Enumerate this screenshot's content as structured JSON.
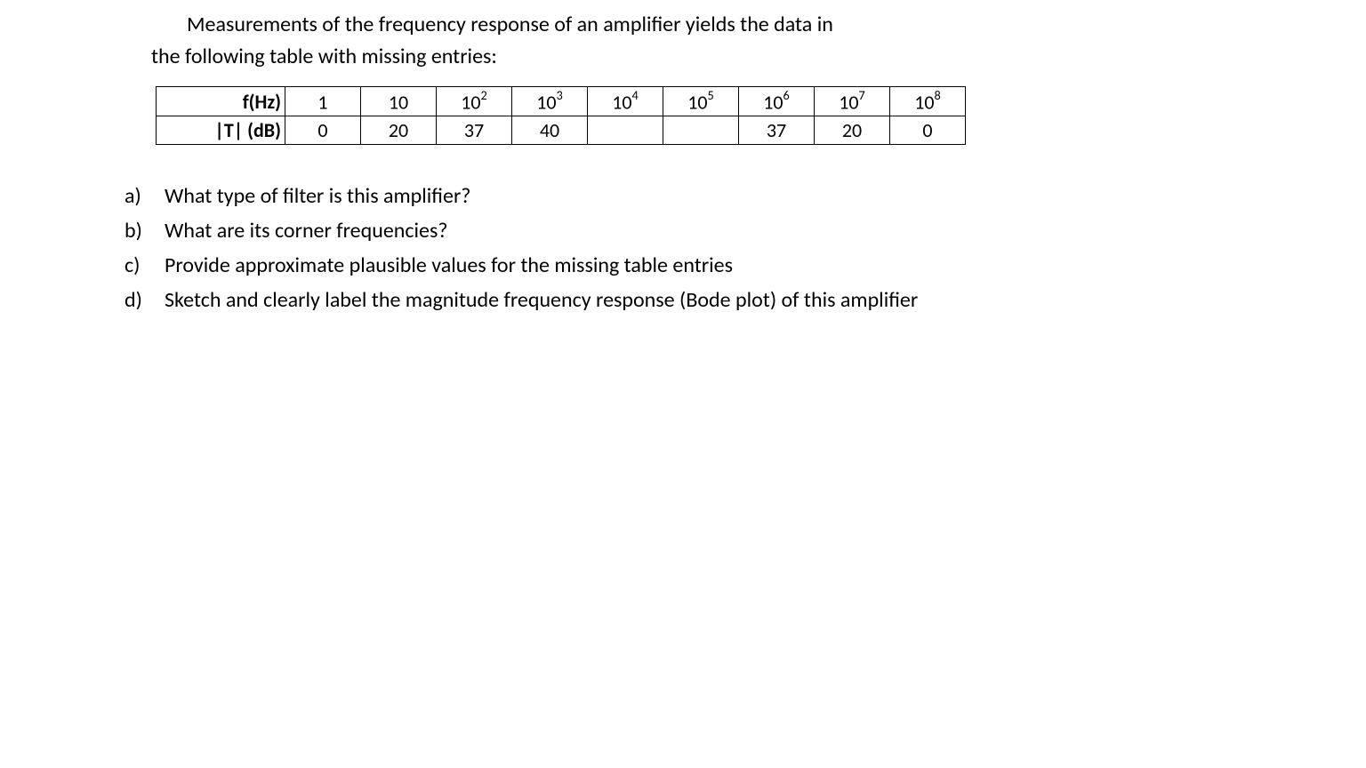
{
  "intro": {
    "line1": "Measurements of the frequency response of an amplifier yields the data in",
    "line2": "the following table with missing entries:"
  },
  "table": {
    "header_label": "f(Hz)",
    "row_label": "|T| (dB)",
    "freq": [
      "1",
      "10",
      "10",
      "10",
      "10",
      "10",
      "10",
      "10",
      "10"
    ],
    "freq_sup": [
      "",
      "",
      "2",
      "3",
      "4",
      "5",
      "6",
      "7",
      "8"
    ],
    "mag": [
      "0",
      "20",
      "37",
      "40",
      "",
      "",
      "37",
      "20",
      "0"
    ]
  },
  "questions": [
    {
      "letter": "a)",
      "text": "What type of filter is this amplifier?"
    },
    {
      "letter": "b)",
      "text": "What are its corner frequencies?"
    },
    {
      "letter": "c)",
      "text": "Provide approximate plausible values for the missing table entries"
    },
    {
      "letter": "d)",
      "text": "Sketch and clearly label the magnitude frequency response (Bode plot) of this amplifier"
    }
  ],
  "chart_data": {
    "type": "table",
    "title": "Amplifier frequency response measurements",
    "columns": [
      "f(Hz)",
      "1",
      "10",
      "10^2",
      "10^3",
      "10^4",
      "10^5",
      "10^6",
      "10^7",
      "10^8"
    ],
    "rows": [
      {
        "label": "|T| (dB)",
        "values": [
          "0",
          "20",
          "37",
          "40",
          "",
          "",
          "37",
          "20",
          "0"
        ]
      }
    ]
  }
}
